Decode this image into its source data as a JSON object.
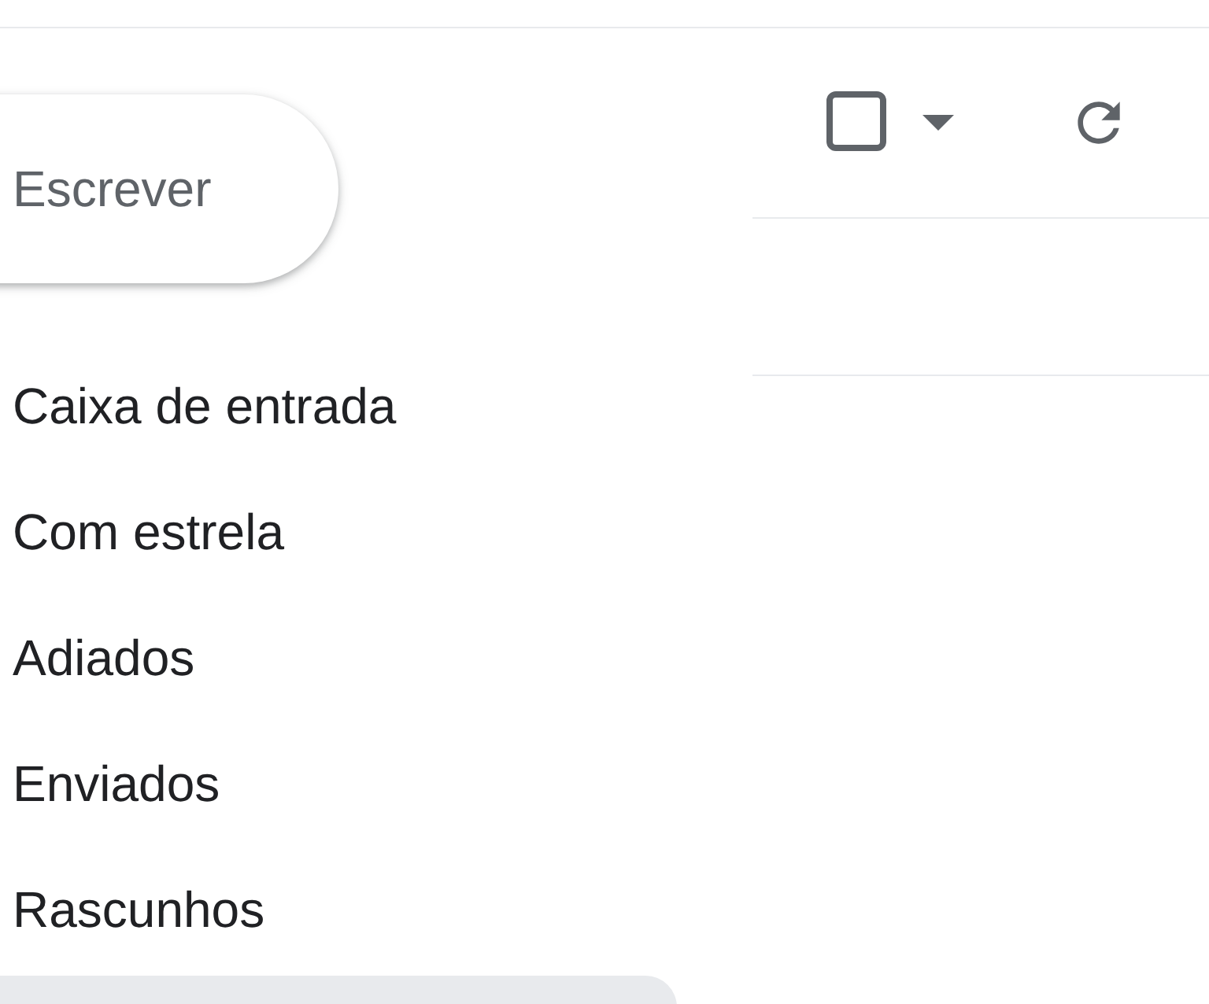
{
  "compose_button": {
    "label": "Escrever"
  },
  "sidebar": {
    "items": [
      {
        "label": "Caixa de entrada"
      },
      {
        "label": "Com estrela"
      },
      {
        "label": "Adiados"
      },
      {
        "label": "Enviados"
      },
      {
        "label": "Rascunhos"
      }
    ]
  },
  "toolbar": {
    "select_all_checked": false
  }
}
